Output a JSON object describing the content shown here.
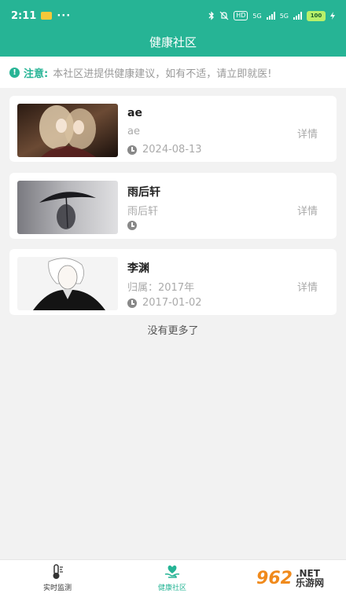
{
  "statusbar": {
    "time": "2:11",
    "dots": "···",
    "signal_labels": [
      "5G",
      "5G"
    ],
    "hd_label": "HD",
    "battery": "100"
  },
  "header": {
    "title": "健康社区"
  },
  "notice": {
    "label": "注意:",
    "text": "本社区进提供健康建议，如有不适，请立即就医!"
  },
  "posts": [
    {
      "title": "ae",
      "subtitle": "ae",
      "date": "2024-08-13",
      "detail": "详情"
    },
    {
      "title": "雨后轩",
      "subtitle": "雨后轩",
      "date": "",
      "detail": "详情"
    },
    {
      "title": "李渊",
      "subtitle": "归属：2017年",
      "date": "2017-01-02",
      "detail": "详情"
    }
  ],
  "list_footer": "没有更多了",
  "bottom_nav": [
    {
      "label": "实时监测",
      "icon": "thermometer-icon",
      "active": false
    },
    {
      "label": "健康社区",
      "icon": "heart-hand-icon",
      "active": true
    }
  ],
  "watermark": {
    "number": "962",
    "text_top": ".NET",
    "text_bottom": "乐游网"
  },
  "colors": {
    "accent": "#26b495",
    "background": "#f2f2f2"
  }
}
